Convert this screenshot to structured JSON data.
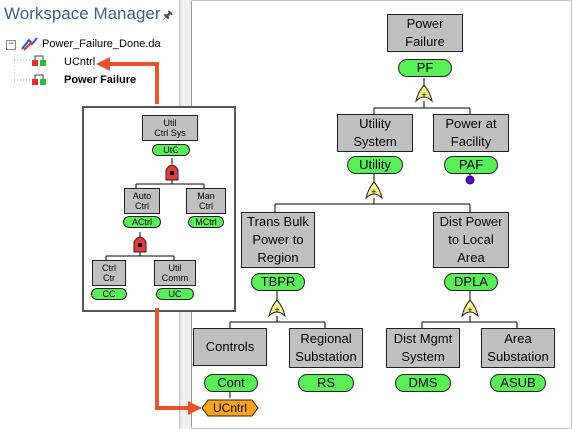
{
  "workspace": {
    "title": "Workspace Manager",
    "file_name": "Power_Failure_Done.da",
    "items": [
      {
        "label": "UCntrl"
      },
      {
        "label": "Power Failure"
      }
    ]
  },
  "main_tree": {
    "top": {
      "title": "Power\nFailure",
      "id": "PF"
    },
    "utility": {
      "title": "Utility\nSystem",
      "id": "Utility"
    },
    "facility": {
      "title": "Power at\nFacility",
      "id": "PAF"
    },
    "trans": {
      "title": "Trans Bulk\nPower to\nRegion",
      "id": "TBPR"
    },
    "dist": {
      "title": "Dist Power\nto Local\nArea",
      "id": "DPLA"
    },
    "controls": {
      "title": "Controls",
      "id": "Cont"
    },
    "regional": {
      "title": "Regional\nSubstation",
      "id": "RS"
    },
    "dms": {
      "title": "Dist Mgmt\nSystem",
      "id": "DMS"
    },
    "area": {
      "title": "Area\nSubstation",
      "id": "ASUB"
    },
    "transfer": {
      "id": "UCntrl"
    }
  },
  "inset_tree": {
    "util_ctrl": {
      "title": "Util\nCtrl Sys",
      "id": "UtC"
    },
    "auto": {
      "title": "Auto\nCtrl",
      "id": "ACtrl"
    },
    "man": {
      "title": "Man\nCtrl",
      "id": "MCtrl"
    },
    "ctrl_ctr": {
      "title": "Ctrl\nCtr",
      "id": "CC"
    },
    "util_comm": {
      "title": "Util\nComm",
      "id": "UC"
    }
  },
  "colors": {
    "event_fill": "#c0c0c0",
    "pill_green": "#58ef58",
    "gate_yellow": "#f7f48e",
    "and_gate_red": "#e33a3a",
    "transfer_orange": "#ffa31a",
    "arrow_red": "#e8552d",
    "basic_event_purple": "#5500ee",
    "title_blue": "#3f5f8f"
  }
}
